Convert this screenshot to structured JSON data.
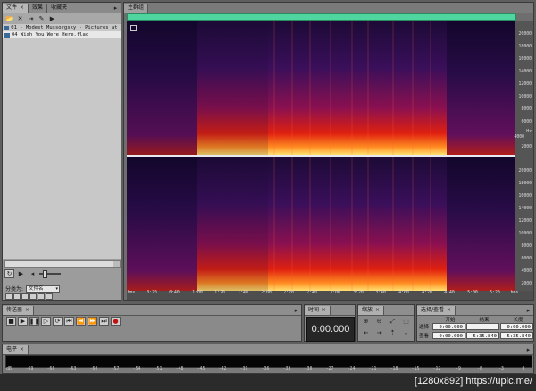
{
  "files_panel": {
    "tabs": [
      {
        "label": "文件",
        "active": true
      },
      {
        "label": "效果",
        "active": false
      },
      {
        "label": "收藏夹",
        "active": false
      }
    ],
    "files": [
      "01 - Modest Mussorgsky - Pictures at an...",
      "04 Wish You Were Here.flac"
    ],
    "sort_label": "分类为:",
    "sort_value": "文件名"
  },
  "editor": {
    "tab_label": "主群组",
    "time_ruler": [
      "hms",
      "0:20",
      "0:40",
      "1:00",
      "1:20",
      "1:40",
      "2:00",
      "2:20",
      "2:40",
      "3:00",
      "3:20",
      "3:40",
      "4:00",
      "4:20",
      "4:40",
      "5:00",
      "5:20",
      "hms"
    ],
    "freq_labels_top": [
      "Hz",
      "20000",
      "18000",
      "16000",
      "14000",
      "12000",
      "10000",
      "8000",
      "6000",
      "4000",
      "2000"
    ],
    "freq_labels_bottom": [
      "20000",
      "18000",
      "16000",
      "14000",
      "12000",
      "10000",
      "8000",
      "6000",
      "4000",
      "2000"
    ]
  },
  "transport": {
    "title": "传送器"
  },
  "time_panel": {
    "title": "时间",
    "display": "0:00.000"
  },
  "zoom_panel": {
    "title": "缩放"
  },
  "selection_panel": {
    "title": "选择/查看",
    "headers": [
      "开始",
      "结束",
      "长度"
    ],
    "rows": [
      {
        "label": "选择",
        "start": "0:00.000",
        "end": "",
        "length": "0:00.000"
      },
      {
        "label": "查看",
        "start": "0:00.000",
        "end": "5:35.840",
        "length": "5:35.840"
      }
    ]
  },
  "level_panel": {
    "title": "电平",
    "scale": [
      "dB",
      "-69",
      "-66",
      "-63",
      "-60",
      "-57",
      "-54",
      "-51",
      "-48",
      "-45",
      "-42",
      "-39",
      "-36",
      "-33",
      "-30",
      "-27",
      "-24",
      "-21",
      "-18",
      "-15",
      "-12",
      "-9",
      "-6",
      "-3",
      "0"
    ]
  },
  "watermark": "[1280x892] https://upic.me/"
}
